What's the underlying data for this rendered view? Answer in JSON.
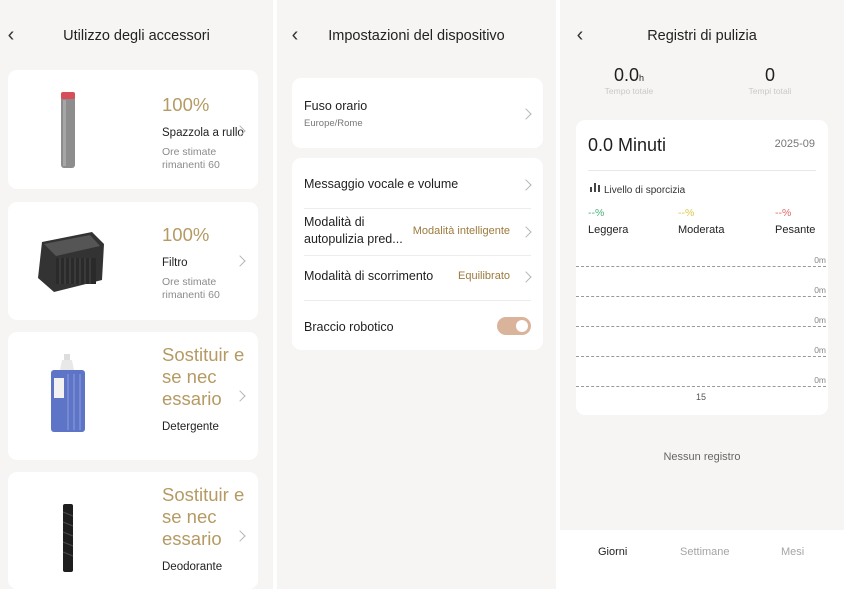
{
  "panel1": {
    "title": "Utilizzo degli accessori",
    "items": [
      {
        "status": "100%",
        "name": "Spazzola a rullo",
        "sub": "Ore stimate rimanenti 60",
        "icon": "roller-brush-icon"
      },
      {
        "status": "100%",
        "name": "Filtro",
        "sub": "Ore stimate rimanenti 60",
        "icon": "filter-icon"
      },
      {
        "status": "Sostituir e se nec essario",
        "name": "Detergente",
        "sub": "",
        "icon": "detergent-bottle-icon"
      },
      {
        "status": "Sostituir e se nec essario",
        "name": "Deodorante",
        "sub": "",
        "icon": "deodorant-icon"
      }
    ]
  },
  "panel2": {
    "title": "Impostazioni del dispositivo",
    "timezone": {
      "label": "Fuso orario",
      "value": "Europe/Rome"
    },
    "voice": {
      "label": "Messaggio vocale e volume"
    },
    "selfclean": {
      "label": "Modalità di autopulizia pred...",
      "value": "Modalità intelligente"
    },
    "scroll": {
      "label": "Modalità di scorrimento",
      "value": "Equilibrato"
    },
    "arm": {
      "label": "Braccio robotico",
      "enabled": true
    },
    "colors": {
      "accent": "#9c7b3e",
      "toggle": "#d9b49a"
    }
  },
  "panel3": {
    "title": "Registri di pulizia",
    "stats": [
      {
        "value": "0.0",
        "unit": "h",
        "label": "Tempo totale"
      },
      {
        "value": "0",
        "unit": "",
        "label": "Tempi totali"
      }
    ],
    "minutes": "0.0 Minuti",
    "month": "2025-09",
    "dirt_title": "Livello di sporcizia",
    "levels": [
      {
        "pct": "--%",
        "name": "Leggera",
        "color": "#4caf7d"
      },
      {
        "pct": "--%",
        "name": "Moderata",
        "color": "#d8c94a"
      },
      {
        "pct": "--%",
        "name": "Pesante",
        "color": "#e06666"
      }
    ],
    "axis_labels": [
      "0m",
      "0m",
      "0m",
      "0m",
      "0m"
    ],
    "x_label": "15",
    "empty": "Nessun registro",
    "tabs": [
      "Giorni",
      "Settimane",
      "Mesi"
    ]
  }
}
